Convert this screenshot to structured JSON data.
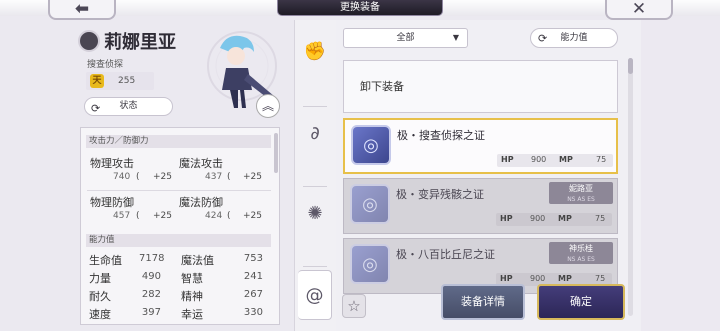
{
  "header": {
    "title": "更换装备",
    "back_glyph": "⬅",
    "close_glyph": "✕"
  },
  "character": {
    "name": "莉娜里亚",
    "class_label": "搜查侦探",
    "rank_icon": "天",
    "rank_value": "255",
    "status_button": "状态"
  },
  "stats": {
    "section_attack": "攻击力／防御力",
    "phys_atk_label": "物理攻击",
    "phys_atk_value": "740",
    "phys_atk_bonus": "+25",
    "mag_atk_label": "魔法攻击",
    "mag_atk_value": "437",
    "mag_atk_bonus": "+25",
    "phys_def_label": "物理防御",
    "phys_def_value": "457",
    "phys_def_bonus": "+25",
    "mag_def_label": "魔法防御",
    "mag_def_value": "424",
    "mag_def_bonus": "+25",
    "section_ability": "能力值",
    "rows": [
      {
        "l1": "生命值",
        "v1": "7178",
        "l2": "魔法值",
        "v2": "753"
      },
      {
        "l1": "力量",
        "v1": "490",
        "l2": "智慧",
        "v2": "241"
      },
      {
        "l1": "耐久",
        "v1": "282",
        "l2": "精神",
        "v2": "267"
      },
      {
        "l1": "速度",
        "v1": "397",
        "l2": "幸运",
        "v2": "330"
      }
    ]
  },
  "filters": {
    "dropdown_value": "全部",
    "sort_button": "能力值"
  },
  "list": {
    "unequip_label": "卸下装备",
    "items": [
      {
        "name": "极・搜查侦探之证",
        "hp_label": "HP",
        "hp": "900",
        "mp_label": "MP",
        "mp": "75",
        "owner": "",
        "owner_sub": ""
      },
      {
        "name": "极・变异残骸之证",
        "hp_label": "HP",
        "hp": "900",
        "mp_label": "MP",
        "mp": "75",
        "owner": "妮路亚",
        "owner_sub": "NS AS ES"
      },
      {
        "name": "极・八百比丘尼之证",
        "hp_label": "HP",
        "hp": "900",
        "mp_label": "MP",
        "mp": "75",
        "owner": "神乐桂",
        "owner_sub": "NS AS ES"
      }
    ]
  },
  "actions": {
    "detail_button": "装备详情",
    "confirm_button": "确定",
    "star_glyph": "☆"
  },
  "colors": {
    "selected_border": "#e7c04a",
    "confirm_bg": "#2c2657",
    "gem": "#5560b0"
  }
}
